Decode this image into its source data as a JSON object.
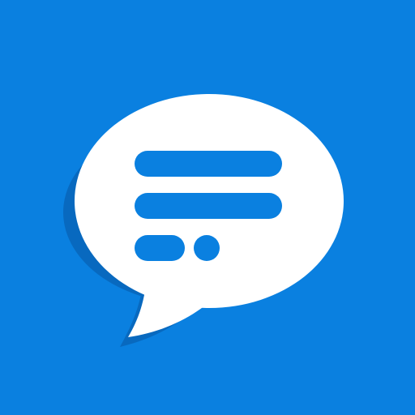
{
  "icon": {
    "name": "chat-bubble-icon",
    "colors": {
      "background": "#0A80E0",
      "shadow": "#0869BF",
      "bubble": "#FFFFFF",
      "text_lines": "#0A80E0"
    }
  }
}
